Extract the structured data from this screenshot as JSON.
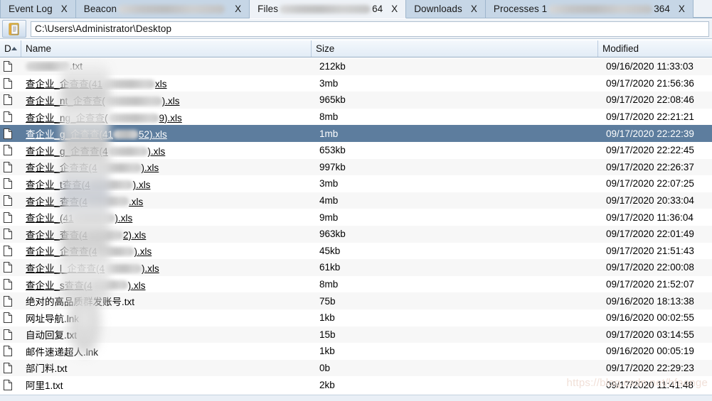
{
  "window": {
    "title": "Files",
    "watermark": "https://blog.csdn.net/hfaonge"
  },
  "tabs": [
    {
      "label": "Event Log",
      "redacted": 0,
      "suffix": "",
      "close": "X",
      "active": false
    },
    {
      "label": "Beacon",
      "redacted": 150,
      "suffix": "",
      "close": "X",
      "active": false
    },
    {
      "label": "Files",
      "redacted": 128,
      "suffix": "64",
      "close": "X",
      "active": true
    },
    {
      "label": "Downloads",
      "redacted": 0,
      "suffix": "",
      "close": "X",
      "active": false
    },
    {
      "label": "Processes 1",
      "redacted": 146,
      "suffix": "364",
      "close": "X",
      "active": false
    }
  ],
  "pathbar": {
    "icon": "folder-document-icon",
    "value": "C:\\Users\\Administrator\\Desktop",
    "placeholder": "Path"
  },
  "columns": {
    "d": "D",
    "name": "Name",
    "size": "Size",
    "modified": "Modified",
    "sort_direction": "asc",
    "sort_column": "D"
  },
  "files": [
    {
      "icon": "file-icon",
      "name_pre": "",
      "blob": 62,
      "name_post": ".txt",
      "link": false,
      "size": "212kb",
      "modified": "09/16/2020 11:33:03",
      "selected": false
    },
    {
      "icon": "file-icon",
      "name_pre": "查企业_",
      "blob": 0,
      "name_post": "企查查(41",
      "blob2": 74,
      "name_post2": "xls",
      "link": true,
      "size": "3mb",
      "modified": "09/17/2020 21:56:36",
      "selected": false
    },
    {
      "icon": "file-icon",
      "name_pre": "查企业_",
      "blob": 0,
      "name_post": "nt_企查查(",
      "blob2": 80,
      "name_post2": ").xls",
      "link": true,
      "size": "965kb",
      "modified": "09/17/2020 22:08:46",
      "selected": false
    },
    {
      "icon": "file-icon",
      "name_pre": "查企业_",
      "blob": 0,
      "name_post": "ng_企查查(",
      "blob2": 72,
      "name_post2": "9).xls",
      "link": true,
      "size": "8mb",
      "modified": "09/17/2020 22:21:21",
      "selected": false
    },
    {
      "icon": "file-icon",
      "name_pre": "查企业_",
      "blob": 0,
      "name_post": "g_企查查(41",
      "blob2": 36,
      "name_post2": "52).xls",
      "link": true,
      "size": "1mb",
      "modified": "09/17/2020 22:22:39",
      "selected": true
    },
    {
      "icon": "file-icon",
      "name_pre": "查企业_",
      "blob": 0,
      "name_post": "g_企查查(4",
      "blob2": 56,
      "name_post2": ").xls",
      "link": true,
      "size": "653kb",
      "modified": "09/17/2020 22:22:45",
      "selected": false
    },
    {
      "icon": "file-icon",
      "name_pre": "查企业_",
      "blob": 0,
      "name_post": "企查查(4",
      "blob2": 62,
      "name_post2": ").xls",
      "link": true,
      "size": "997kb",
      "modified": "09/17/2020 22:26:37",
      "selected": false
    },
    {
      "icon": "file-icon",
      "name_pre": "查企业_",
      "blob": 0,
      "name_post": "t查查(4",
      "blob2": 60,
      "name_post2": ").xls",
      "link": true,
      "size": "3mb",
      "modified": "09/17/2020 22:07:25",
      "selected": false
    },
    {
      "icon": "file-icon",
      "name_pre": "查企业_",
      "blob": 0,
      "name_post": "查查(4",
      "blob2": 58,
      "name_post2": ".xls",
      "link": true,
      "size": "4mb",
      "modified": "09/17/2020 20:33:04",
      "selected": false
    },
    {
      "icon": "file-icon",
      "name_pre": "查企业_",
      "blob": 0,
      "name_post": "(41",
      "blob2": 58,
      "name_post2": ").xls",
      "link": true,
      "size": "9mb",
      "modified": "09/17/2020 11:36:04",
      "selected": false
    },
    {
      "icon": "file-icon",
      "name_pre": "查企业_",
      "blob": 0,
      "name_post": "查查(4",
      "blob2": 50,
      "name_post2": "2).xls",
      "link": true,
      "size": "963kb",
      "modified": "09/17/2020 22:01:49",
      "selected": false
    },
    {
      "icon": "file-icon",
      "name_pre": "查企业_",
      "blob": 0,
      "name_post": "企查查(4",
      "blob2": 52,
      "name_post2": ").xls",
      "link": true,
      "size": "45kb",
      "modified": "09/17/2020 21:51:43",
      "selected": false
    },
    {
      "icon": "file-icon",
      "name_pre": "查企业_",
      "blob": 0,
      "name_post": "l_企查查(4",
      "blob2": 52,
      "name_post2": ").xls",
      "link": true,
      "size": "61kb",
      "modified": "09/17/2020 22:00:08",
      "selected": false
    },
    {
      "icon": "file-icon",
      "name_pre": "查企业_s",
      "blob": 0,
      "name_post": "查查(4",
      "blob2": 50,
      "name_post2": ").xls",
      "link": true,
      "size": "8mb",
      "modified": "09/17/2020 21:52:07",
      "selected": false
    },
    {
      "icon": "file-icon",
      "name_pre": "绝对的高品质群发账号.txt",
      "blob": 0,
      "name_post": "",
      "link": false,
      "size": "75b",
      "modified": "09/16/2020 18:13:38",
      "selected": false
    },
    {
      "icon": "file-icon",
      "name_pre": "网址导航.lnk",
      "blob": 0,
      "name_post": "",
      "link": false,
      "size": "1kb",
      "modified": "09/16/2020 00:02:55",
      "selected": false
    },
    {
      "icon": "file-icon",
      "name_pre": "自动回复.txt",
      "blob": 0,
      "name_post": "",
      "link": false,
      "size": "15b",
      "modified": "09/17/2020 03:14:55",
      "selected": false
    },
    {
      "icon": "file-icon",
      "name_pre": "邮件速递超人.lnk",
      "blob": 0,
      "name_post": "",
      "link": false,
      "size": "1kb",
      "modified": "09/16/2020 00:05:19",
      "selected": false
    },
    {
      "icon": "file-icon",
      "name_pre": "部门料.txt",
      "blob": 0,
      "name_post": "",
      "link": false,
      "size": "0b",
      "modified": "09/17/2020 22:29:23",
      "selected": false
    },
    {
      "icon": "file-icon",
      "name_pre": "阿里1.txt",
      "blob": 0,
      "name_post": "",
      "link": false,
      "size": "2kb",
      "modified": "09/17/2020 11:41:48",
      "selected": false
    }
  ],
  "colors": {
    "tab_active": "#eef2f7",
    "tab_inactive": "#c6d6e6",
    "selection": "#5d7d9e",
    "header_border": "#9aafc4",
    "row_alt": "#f7f7f7"
  }
}
